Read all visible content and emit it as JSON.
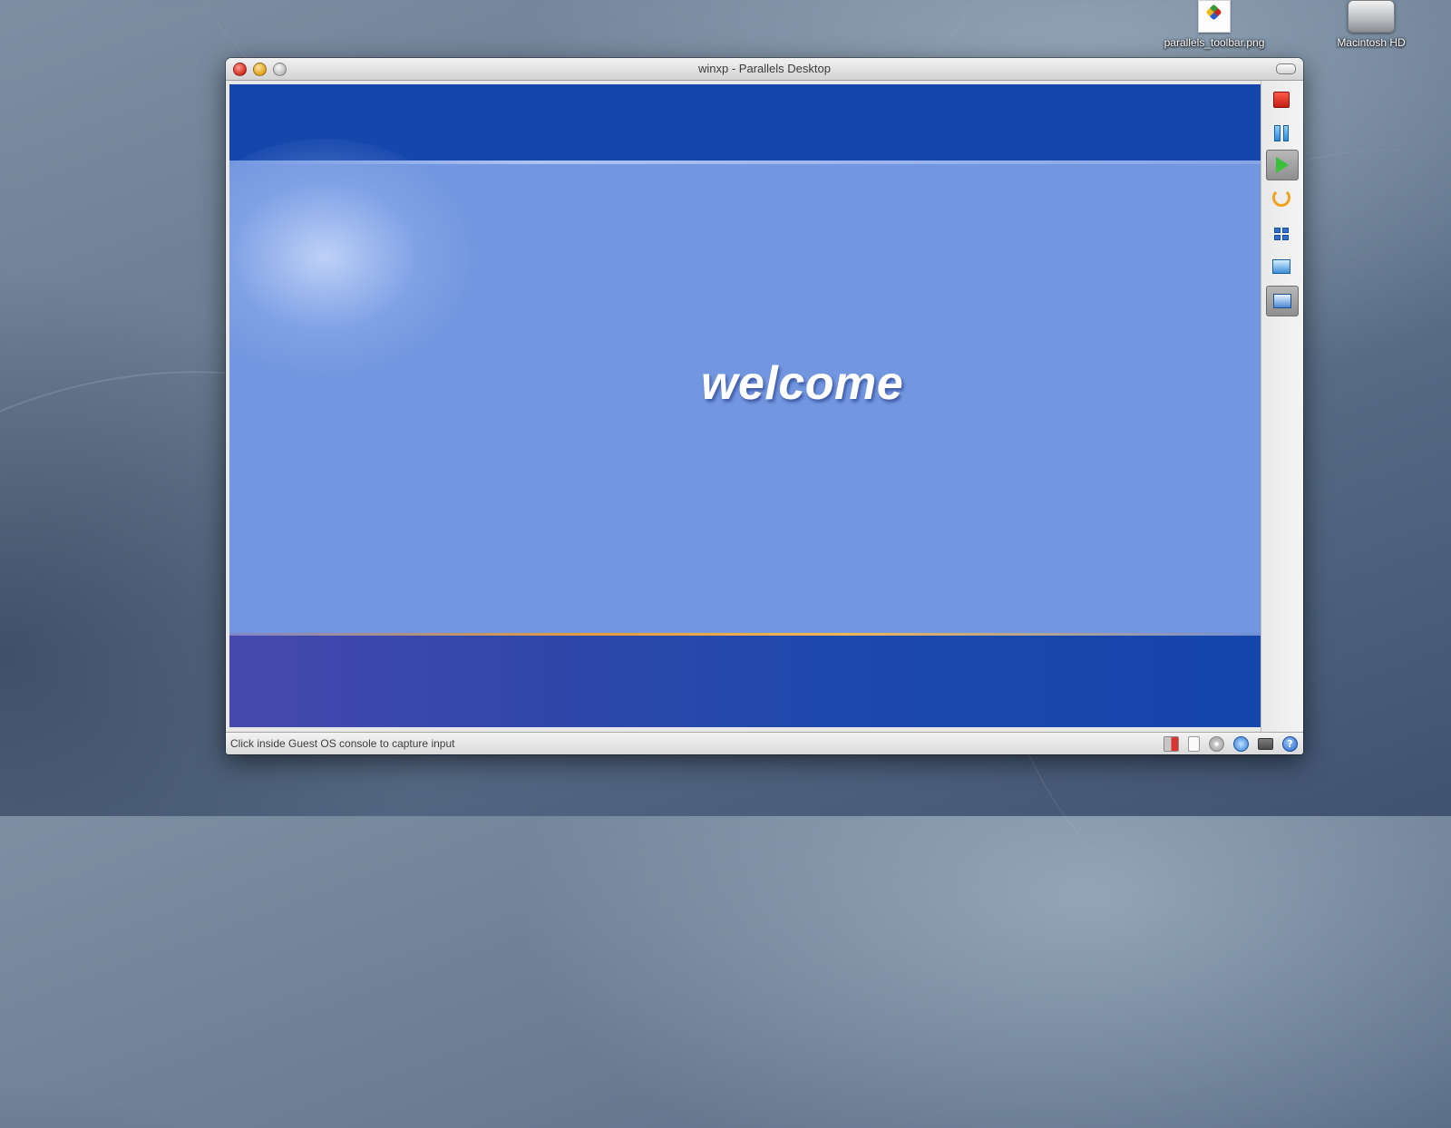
{
  "desktop": {
    "icons": [
      {
        "label": "parallels_toolbar.png",
        "icon": "png-file-icon"
      },
      {
        "label": "Macintosh HD",
        "icon": "hard-drive-icon"
      }
    ]
  },
  "window": {
    "title": "winxp - Parallels Desktop",
    "status_message": "Click inside Guest OS console to capture input",
    "guest_screen": {
      "welcome_text": "welcome"
    },
    "toolbar": [
      {
        "name": "stop",
        "icon": "stop-icon",
        "active": false
      },
      {
        "name": "pause",
        "icon": "pause-icon",
        "active": false
      },
      {
        "name": "play",
        "icon": "play-icon",
        "active": true
      },
      {
        "name": "restart",
        "icon": "restart-icon",
        "active": false
      },
      {
        "name": "full-screen",
        "icon": "grid-icon",
        "active": false
      },
      {
        "name": "screenshot",
        "icon": "screenshot-icon",
        "active": false
      },
      {
        "name": "capture-input",
        "icon": "capture-icon",
        "active": true
      }
    ],
    "status_icons": [
      "network-icon",
      "floppy-icon",
      "cd-icon",
      "usb-icon",
      "printer-icon",
      "help-icon"
    ]
  },
  "colors": {
    "xp_dark_blue": "#1446ab",
    "xp_light_blue": "#7296df",
    "accent_orange": "#e79b3a"
  }
}
